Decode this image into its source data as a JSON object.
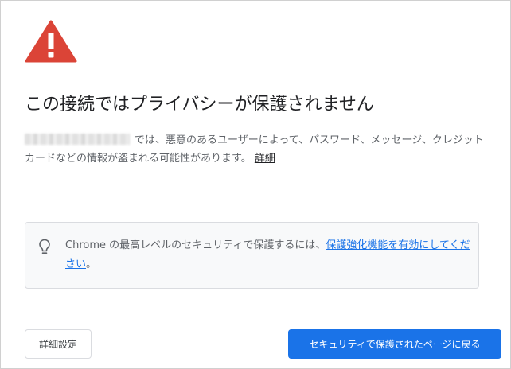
{
  "page": {
    "title": "この接続ではプライバシーが保護されません",
    "description_after_domain": "では、悪意のあるユーザーによって、パスワード、メッセージ、クレジット カードなどの情報が盗まれる可能性があります。",
    "details_link": "詳細"
  },
  "tip": {
    "text_before_link": "Chrome の最高レベルのセキュリティで保護するには、",
    "link": "保護強化機能を有効にしてください",
    "text_after_link": "。"
  },
  "buttons": {
    "advanced": "詳細設定",
    "back_to_safety": "セキュリティで保護されたページに戻る"
  },
  "colors": {
    "warning_red": "#db4437",
    "primary_blue": "#1a73e8",
    "body_text": "#5f6368",
    "title_text": "#202124",
    "tip_background": "#f8f9fa"
  },
  "icons": {
    "warning": "warning-triangle-icon",
    "tip": "lightbulb-icon"
  }
}
